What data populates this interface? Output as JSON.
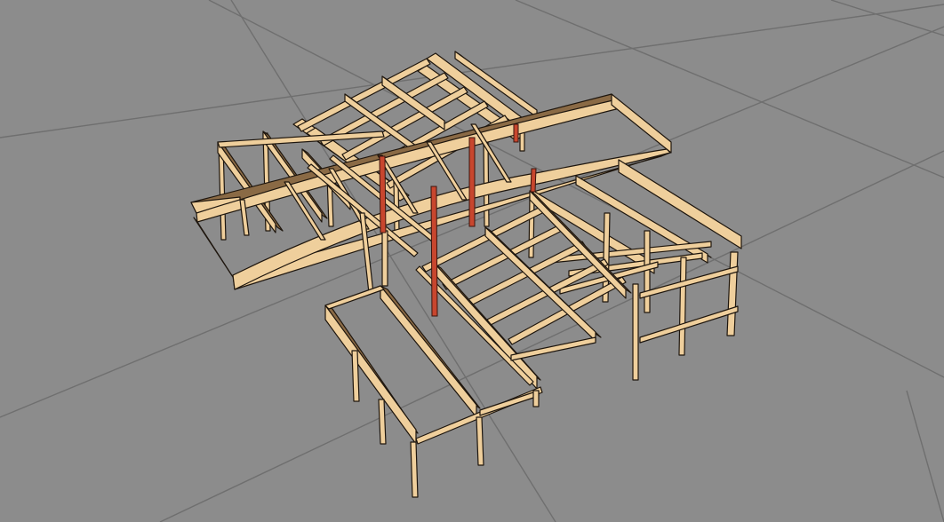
{
  "scene": {
    "background_color": "#8c8c8c",
    "grid_color": "#6f6f6f",
    "wood_face_color": "#efcf9c",
    "wood_side_color": "#8a6a45",
    "wood_outline_color": "#1e160e",
    "steel_column_color": "#c8462e",
    "objects": [
      "ground-grid",
      "timber-frame-structure",
      "steel-columns"
    ]
  }
}
